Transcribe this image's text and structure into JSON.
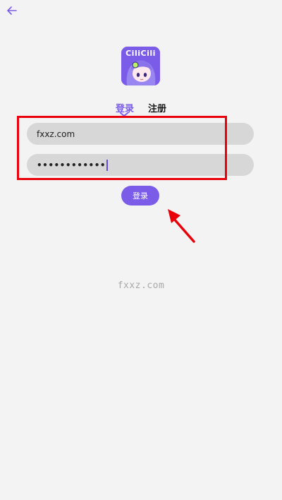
{
  "header": {
    "back_icon": "arrow-left-icon"
  },
  "logo": {
    "text": "CiliCili"
  },
  "tabs": {
    "login_label": "登录",
    "register_label": "注册",
    "active": "login"
  },
  "form": {
    "username_value": "fxxz.com",
    "password_masked": "••••••••••••"
  },
  "login_button": {
    "label": "登录"
  },
  "watermark": "fxxz.com",
  "colors": {
    "accent": "#7b5ce8",
    "background": "#f3f3f3",
    "input_bg": "#d7d7d7",
    "annotation_red": "#e8000b"
  }
}
